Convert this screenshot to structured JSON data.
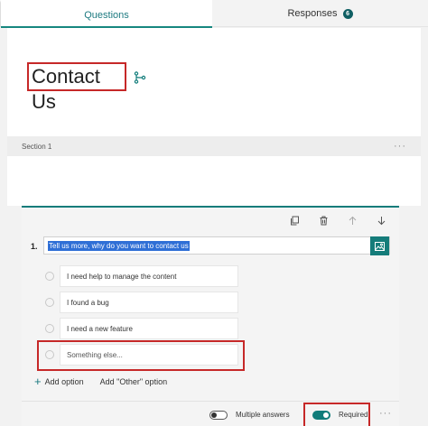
{
  "tabs": {
    "questions": "Questions",
    "responses": "Responses",
    "responses_count": "6"
  },
  "form": {
    "title": "Contact Us"
  },
  "section": {
    "label": "Section 1",
    "more": "···"
  },
  "question": {
    "number": "1.",
    "text": "Tell us more, why do you want to contact us",
    "options": [
      "I need help to manage the content",
      "I found a bug",
      "I need a new feature"
    ],
    "new_option_placeholder": "Something else...",
    "add_option": "Add option",
    "add_other": "Add \"Other\" option",
    "multiple_answers_label": "Multiple answers",
    "multiple_answers_on": false,
    "required_label": "Required",
    "required_on": true,
    "more": "···"
  },
  "colors": {
    "accent": "#107c7a",
    "highlight": "#c62828",
    "selection": "#2f6fd6"
  }
}
